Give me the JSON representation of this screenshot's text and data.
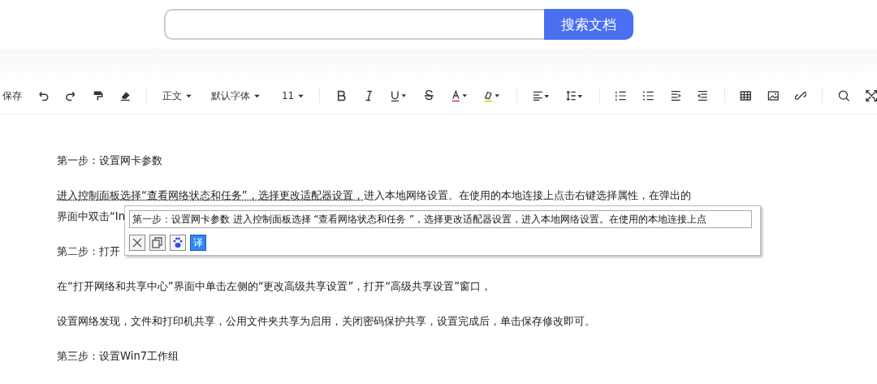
{
  "search": {
    "button": "搜索文档"
  },
  "toolbar": {
    "save": "保存",
    "paragraph_style": "正文",
    "font": "默认字体",
    "font_size": "11"
  },
  "document": {
    "lines": [
      {
        "text": "第一步：设置网卡参数"
      },
      {
        "link": "进入控制面板选择“查看网络状态和任务”，选择更改适配器设置，",
        "text": "进入本地网络设置。在使用的本地连接上点击右键选择属性，在弹出的"
      },
      {
        "text": "界面中双击“In"
      },
      {
        "text": "第二步：打开"
      },
      {
        "text": "在“打开网络和共享中心”界面中单击左侧的“更改高级共享设置”，打开“高级共享设置”窗口，"
      },
      {
        "text": "设置网络发现，文件和打印机共享，公用文件夹共享为启用，关闭密码保护共享，设置完成后，单击保存修改即可。"
      },
      {
        "text": "第三步：设置Win7工作组"
      }
    ]
  },
  "popup": {
    "value": "第一步：设置网卡参数 进入控制面板选择 “查看网络状态和任务 ”，选择更改适配器设置，进入本地网络设置。在使用的本地连接上点",
    "translate": "译"
  }
}
